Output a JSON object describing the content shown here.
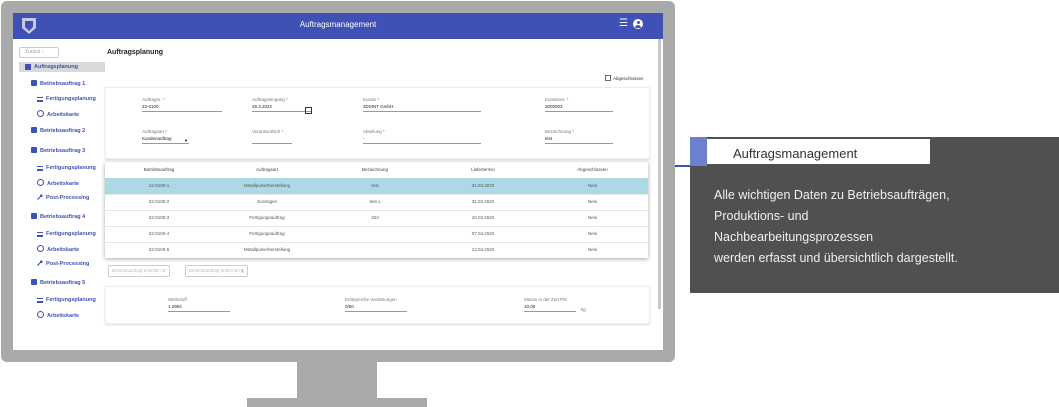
{
  "app": {
    "title": "Auftragsmanagement"
  },
  "sidebar": {
    "back": "Zurück",
    "selected": "Auftragsplanung",
    "items": [
      {
        "label": "Betriebsauftrag 1"
      },
      {
        "label": "Fertigungsplanung"
      },
      {
        "label": "Arbeitskarte"
      },
      {
        "label": "Betriebsauftrag 2"
      },
      {
        "label": "Betriebsauftrag 3"
      },
      {
        "label": "Fertigungsplanung"
      },
      {
        "label": "Arbeitskarte"
      },
      {
        "label": "Post-Processing"
      },
      {
        "label": "Betriebsauftrag 4"
      },
      {
        "label": "Fertigungsplanung"
      },
      {
        "label": "Arbeitskarte"
      },
      {
        "label": "Post-Processing"
      },
      {
        "label": "Betriebsauftrag 5"
      },
      {
        "label": "Fertigungsplanung"
      },
      {
        "label": "Arbeitskarte"
      }
    ]
  },
  "main": {
    "title": "Auftragsplanung",
    "abgeschlossen": "Abgeschlossen",
    "fields": [
      {
        "label": "Auftragnr. *",
        "value": "22-0100"
      },
      {
        "label": "Auftragseingang *",
        "value": "29.3.2022"
      },
      {
        "label": "Kunde *",
        "value": "3DSINT GmbH"
      },
      {
        "label": "Kundennr. *",
        "value": "3000003"
      },
      {
        "label": "Auftragsart *",
        "value": "Kundenauftrag"
      },
      {
        "label": "Verantwortlich *",
        "value": ""
      },
      {
        "label": "Abteilung *",
        "value": "-"
      },
      {
        "label": "Bezeichnung *",
        "value": "test"
      }
    ],
    "table": {
      "headers": [
        "Betriebsauftrag",
        "Auftragsart",
        "Bezeichnung",
        "Liefertermin",
        "Abgeschlossen"
      ],
      "rows": [
        [
          "22-0100-1",
          "Metallpulverherstellung",
          "test",
          "31.03.2022",
          "Nein"
        ],
        [
          "22-0100-2",
          "Sonstiges",
          "test o",
          "31.03.2022",
          "Nein"
        ],
        [
          "22-0100-3",
          "Fertigungsauftrag",
          "323",
          "10.03.2022",
          "Nein"
        ],
        [
          "22-0100-4",
          "Fertigungsauftrag",
          "",
          "07.04.2022",
          "Nein"
        ],
        [
          "22-0100-5",
          "Metallpulverherstellung",
          "",
          "12.04.2022",
          "Nein"
        ]
      ]
    },
    "buttons": {
      "create": "Betriebsauftrag erstellen",
      "remove": "Betriebsauftrag entfernen"
    },
    "bottom": [
      {
        "label": "Werkstoff",
        "value": "1.2964"
      },
      {
        "label": "Erfolgreiche Verdüsungen",
        "value": "0/50"
      },
      {
        "label": "Masse in der Zerl.P0/",
        "value": "10,00",
        "unit": "kg"
      }
    ]
  },
  "info": {
    "title": "Auftragsmanagement",
    "description": "Alle wichtigen Daten zu Betriebsaufträgen,\nProduktions- und\nNachbearbeitungsprozessen\nwerden erfasst und übersichtlich dargestellt."
  },
  "colors": {
    "primary": "#3f51b5",
    "highlight_row": "#add8e6",
    "panel": "#505050",
    "monitor": "#a9a9a9"
  }
}
